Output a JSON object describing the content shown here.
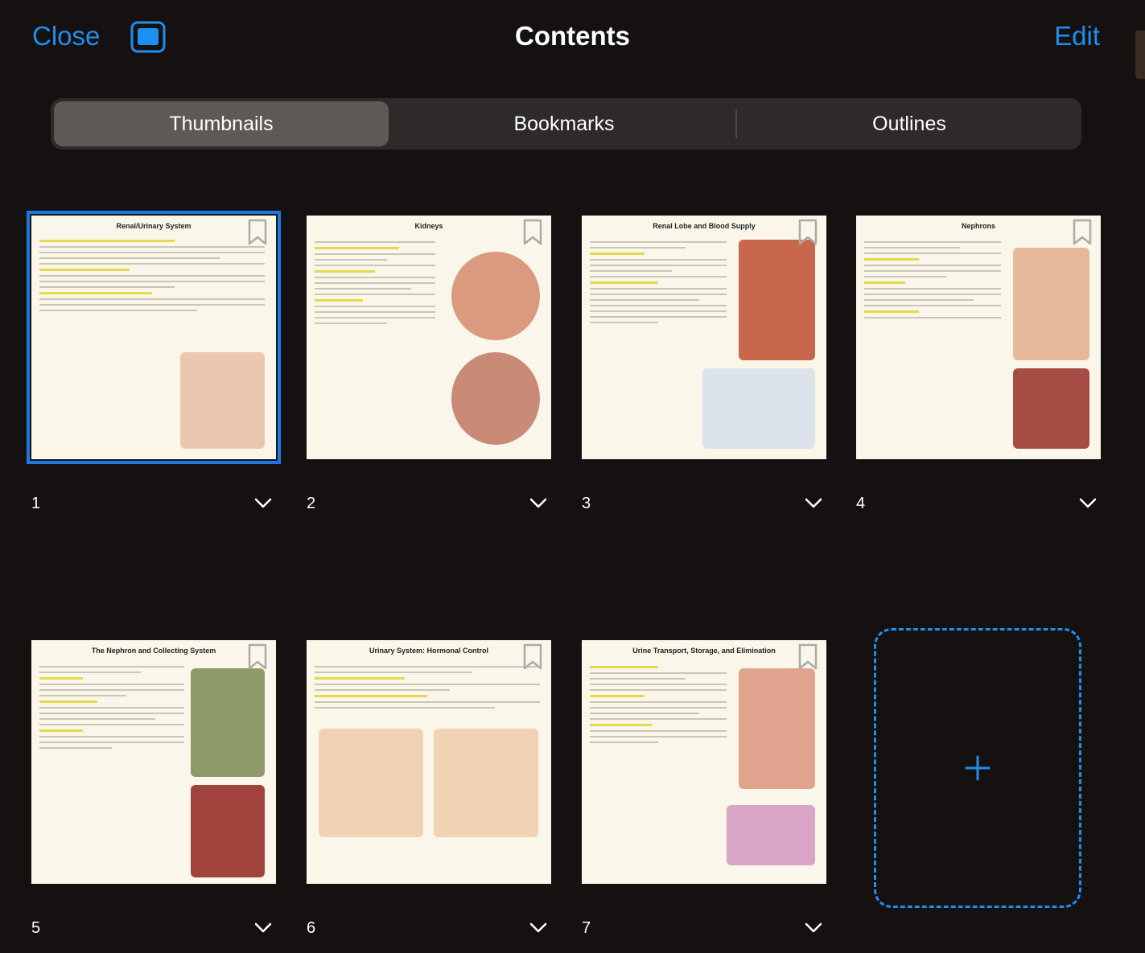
{
  "header": {
    "close_label": "Close",
    "title": "Contents",
    "edit_label": "Edit"
  },
  "tabs": [
    {
      "label": "Thumbnails",
      "active": true
    },
    {
      "label": "Bookmarks",
      "active": false
    },
    {
      "label": "Outlines",
      "active": false
    }
  ],
  "pages": [
    {
      "number": "1",
      "title": "Renal/Urinary System",
      "selected": true
    },
    {
      "number": "2",
      "title": "Kidneys",
      "selected": false
    },
    {
      "number": "3",
      "title": "Renal Lobe and Blood Supply",
      "selected": false
    },
    {
      "number": "4",
      "title": "Nephrons",
      "selected": false
    },
    {
      "number": "5",
      "title": "The Nephron and Collecting System",
      "selected": false
    },
    {
      "number": "6",
      "title": "Urinary System: Hormonal Control",
      "selected": false
    },
    {
      "number": "7",
      "title": "Urine Transport, Storage, and Elimination",
      "selected": false
    }
  ],
  "colors": {
    "accent": "#1e8ef0",
    "background": "#151110",
    "selection": "#1d78e6"
  },
  "icons": {
    "sidebar_toggle": "sidebar-toggle-icon",
    "bookmark": "bookmark-icon",
    "chevron": "chevron-down-icon",
    "add": "plus-icon"
  }
}
